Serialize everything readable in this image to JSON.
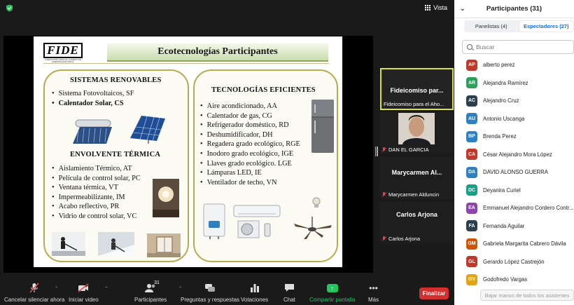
{
  "topbar": {
    "view_label": "Vista"
  },
  "slide": {
    "logo_text": "FIDE",
    "logo_sub": "FIDEICOMISO PARA EL AHORRO DE ENERGÍA ELÉCTRICA",
    "title": "Ecotecnologías Participantes",
    "left_heading": "SISTEMAS RENOVABLES",
    "left_items": [
      "Sistema Fotovoltaicos, SF",
      "Calentador Solar, CS"
    ],
    "envolvente_heading": "ENVOLVENTE TÉRMICA",
    "envolvente_items": [
      "Aislamiento Térmico, AT",
      "Película de control solar, PC",
      "Ventana térmica, VT",
      "Impermeabilizante, IM",
      "Acabo reflectivo, PR",
      "Vidrio de control solar, VC"
    ],
    "right_heading": "TECNOLOGÍAS  EFICIENTES",
    "right_items": [
      "Aire acondicionado, AA",
      "Calentador de gas, CG",
      "Refrigerador doméstico, RD",
      "Deshumidificador, DH",
      "Regadera grado ecológico, RGE",
      "Inodoro grado ecológico, IGE",
      "Llaves grado ecológico. LGE",
      "Lámparas LED, IE",
      "Ventilador de techo, VN"
    ]
  },
  "tiles": [
    {
      "title": "Fideicomiso  par...",
      "name": "Fideicomiso para el Aho..."
    },
    {
      "title": "",
      "name": "DAN EL GARCIA"
    },
    {
      "title": "Marycarmen  Al...",
      "name": "Marycarmen Alduncin"
    },
    {
      "title": "Carlos Arjona",
      "name": "Carlos Arjona"
    }
  ],
  "toolbar": {
    "mute": "Cancelar silenciar ahora",
    "video": "Iniciar video",
    "participants": "Participantes",
    "participants_count": "31",
    "qa": "Preguntas y respuestas",
    "polls": "Votaciones",
    "chat": "Chat",
    "share": "Compartir pantalla",
    "more": "Más",
    "end": "Finalizar"
  },
  "panel": {
    "title": "Participantes (31)",
    "tab_panelists": "Panelistas (4)",
    "tab_attendees": "Espectadores (27)",
    "search_placeholder": "Buscar",
    "lower_hands": "Bajar manos de todos los asistentes",
    "attendees": [
      {
        "initials": "AP",
        "name": "alberto perez",
        "color": "#c0392b"
      },
      {
        "initials": "AR",
        "name": "Alejandra Ramírez",
        "color": "#2e9e5b"
      },
      {
        "initials": "AC",
        "name": "Alejandro Cruz",
        "color": "#2c3e50"
      },
      {
        "initials": "AU",
        "name": "Antonio Uscanga",
        "color": "#2f80c2"
      },
      {
        "initials": "BP",
        "name": "Brenda Perez",
        "color": "#2f80c2"
      },
      {
        "initials": "CA",
        "name": "César Alejandro Mora López",
        "color": "#c0392b"
      },
      {
        "initials": "DA",
        "name": "DAVID ALONSO GUERRA",
        "color": "#2f80c2"
      },
      {
        "initials": "DC",
        "name": "Deyanira Curiel",
        "color": "#16a085"
      },
      {
        "initials": "EA",
        "name": "Emmanuel Alejandro Cordero Contr...",
        "color": "#8e44ad"
      },
      {
        "initials": "FA",
        "name": "Fernanda Aguilar",
        "color": "#2c3e50"
      },
      {
        "initials": "GM",
        "name": "Gabriela Margarita Cabrero Dávila",
        "color": "#d35400"
      },
      {
        "initials": "GL",
        "name": "Gerardo López Castrejón",
        "color": "#c0392b"
      },
      {
        "initials": "GV",
        "name": "Godofredo Vargas",
        "color": "#e1a317"
      }
    ]
  }
}
